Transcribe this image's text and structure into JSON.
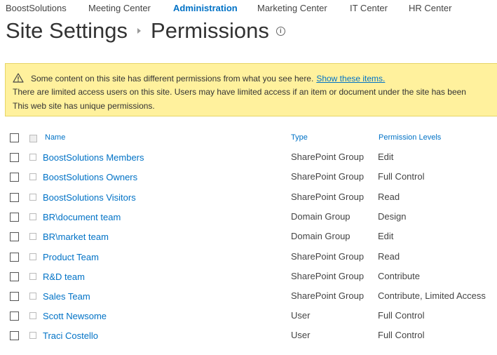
{
  "top_nav": [
    {
      "label": "BoostSolutions",
      "active": false
    },
    {
      "label": "Meeting Center",
      "active": false
    },
    {
      "label": "Administration",
      "active": true
    },
    {
      "label": "Marketing Center",
      "active": false
    },
    {
      "label": "IT Center",
      "active": false
    },
    {
      "label": "HR Center",
      "active": false
    }
  ],
  "title": {
    "part1": "Site Settings",
    "part2": "Permissions",
    "info_icon": "info-icon"
  },
  "warning": {
    "line1": "Some content on this site has different permissions from what you see here.",
    "link": "Show these items.",
    "line2": "There are limited access users on this site. Users may have limited access if an item or document under the site has been",
    "line3": "This web site has unique permissions.",
    "icon": "warning-icon",
    "bg_color": "#fff19d"
  },
  "table": {
    "headers": {
      "name": "Name",
      "type": "Type",
      "permission": "Permission Levels"
    },
    "rows": [
      {
        "name": "BoostSolutions Members",
        "type": "SharePoint Group",
        "permission": "Edit"
      },
      {
        "name": "BoostSolutions Owners",
        "type": "SharePoint Group",
        "permission": "Full Control"
      },
      {
        "name": "BoostSolutions Visitors",
        "type": "SharePoint Group",
        "permission": "Read"
      },
      {
        "name": "BR\\document team",
        "type": "Domain Group",
        "permission": "Design"
      },
      {
        "name": "BR\\market team",
        "type": "Domain Group",
        "permission": "Edit"
      },
      {
        "name": "Product Team",
        "type": "SharePoint Group",
        "permission": "Read"
      },
      {
        "name": "R&D team",
        "type": "SharePoint Group",
        "permission": "Contribute"
      },
      {
        "name": "Sales Team",
        "type": "SharePoint Group",
        "permission": "Contribute, Limited Access"
      },
      {
        "name": "Scott Newsome",
        "type": "User",
        "permission": "Full Control"
      },
      {
        "name": "Traci Costello",
        "type": "User",
        "permission": "Full Control"
      }
    ]
  },
  "colors": {
    "link": "#0072c6",
    "text": "#444444"
  }
}
